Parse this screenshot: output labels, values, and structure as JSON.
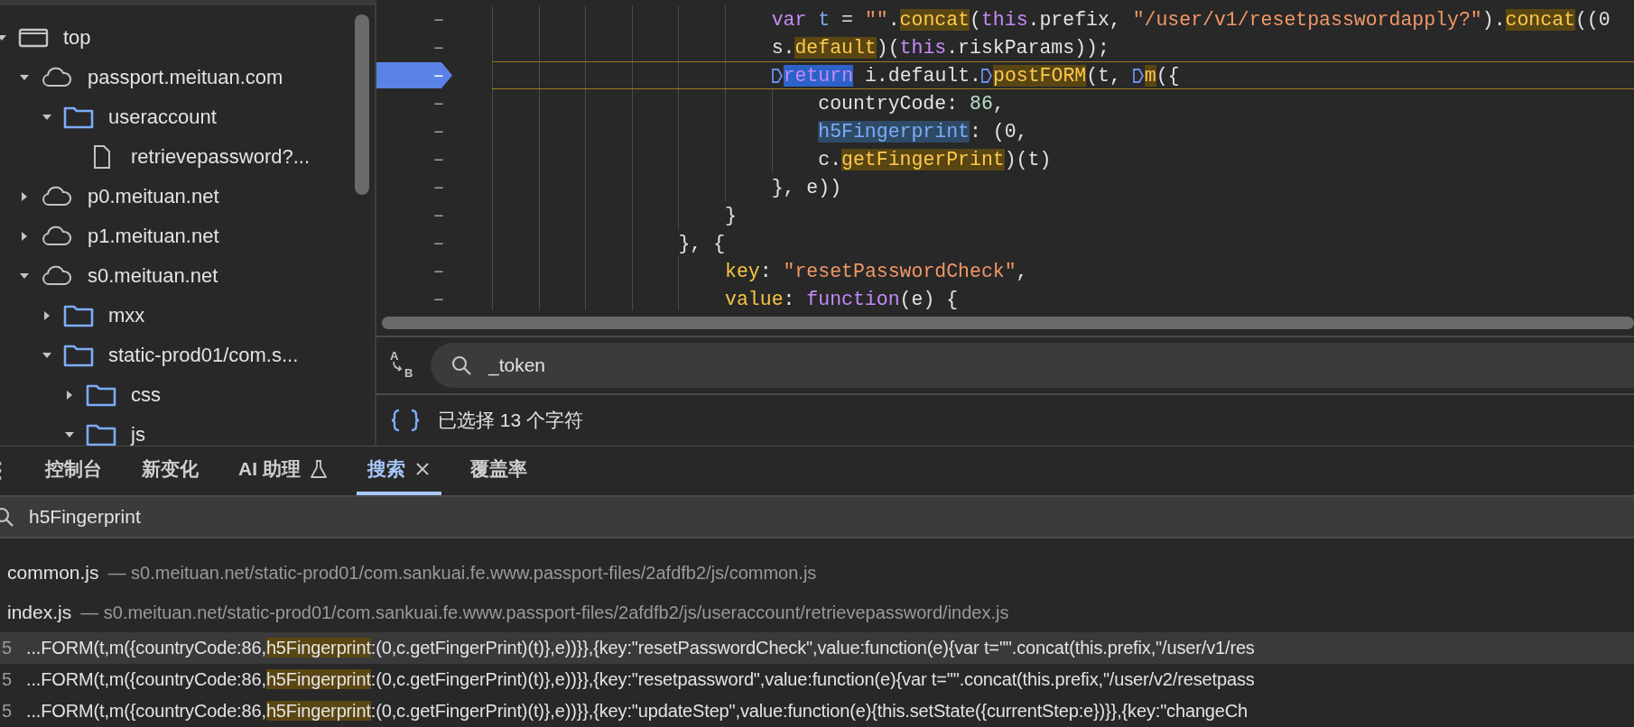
{
  "sidebar": {
    "tree": [
      {
        "label": "top",
        "kind": "frame",
        "expanded": true,
        "children": [
          {
            "label": "passport.meituan.com",
            "kind": "domain",
            "expanded": true,
            "children": [
              {
                "label": "useraccount",
                "kind": "folder",
                "expanded": true,
                "children": [
                  {
                    "label": "retrievepassword?...",
                    "kind": "file"
                  }
                ]
              }
            ]
          },
          {
            "label": "p0.meituan.net",
            "kind": "domain",
            "expanded": false
          },
          {
            "label": "p1.meituan.net",
            "kind": "domain",
            "expanded": false
          },
          {
            "label": "s0.meituan.net",
            "kind": "domain",
            "expanded": true,
            "children": [
              {
                "label": "mxx",
                "kind": "folder",
                "expanded": false
              },
              {
                "label": "static-prod01/com.s...",
                "kind": "folder",
                "expanded": true,
                "children": [
                  {
                    "label": "css",
                    "kind": "folder",
                    "expanded": false
                  },
                  {
                    "label": "js",
                    "kind": "folder",
                    "expanded": true
                  }
                ]
              }
            ]
          }
        ]
      }
    ]
  },
  "editor": {
    "lines": [
      {
        "gutter": "–",
        "breakpoint": false,
        "current": false,
        "tokens": [
          {
            "kind": "keyword",
            "t": "                        var "
          },
          {
            "kind": "variable",
            "t": "t"
          },
          {
            "kind": "plain",
            "t": " = "
          },
          {
            "kind": "string",
            "t": "\"\""
          },
          {
            "kind": "plain",
            "t": "."
          },
          {
            "kind": "hit",
            "t": "concat"
          },
          {
            "kind": "plain",
            "t": "("
          },
          {
            "kind": "keyword",
            "t": "this"
          },
          {
            "kind": "plain",
            "t": ".prefix, "
          },
          {
            "kind": "string",
            "t": "\"/user/v1/resetpasswordapply?\""
          },
          {
            "kind": "plain",
            "t": ")."
          },
          {
            "kind": "hit",
            "t": "concat"
          },
          {
            "kind": "plain",
            "t": "((0"
          }
        ]
      },
      {
        "gutter": "–",
        "breakpoint": false,
        "current": false,
        "tokens": [
          {
            "kind": "plain",
            "t": "                        s."
          },
          {
            "kind": "hit",
            "t": "default"
          },
          {
            "kind": "plain",
            "t": ")("
          },
          {
            "kind": "keyword",
            "t": "this"
          },
          {
            "kind": "plain",
            "t": ".riskParams));"
          }
        ]
      },
      {
        "gutter": "–",
        "breakpoint": true,
        "current": true,
        "tokens": [
          {
            "kind": "marker"
          },
          {
            "kind": "paused",
            "t": "                        return"
          },
          {
            "kind": "plain",
            "t": " i.default."
          },
          {
            "kind": "marker"
          },
          {
            "kind": "hit",
            "t": "postFORM"
          },
          {
            "kind": "plain",
            "t": "(t, "
          },
          {
            "kind": "marker"
          },
          {
            "kind": "hit",
            "t": "m"
          },
          {
            "kind": "plain",
            "t": "({"
          }
        ]
      },
      {
        "gutter": "–",
        "breakpoint": false,
        "current": false,
        "tokens": [
          {
            "kind": "plain",
            "t": "                            countryCode: "
          },
          {
            "kind": "number",
            "t": "86"
          },
          {
            "kind": "plain",
            "t": ","
          }
        ]
      },
      {
        "gutter": "–",
        "breakpoint": false,
        "current": false,
        "tokens": [
          {
            "kind": "selection",
            "t": "                            h5Fingerprint"
          },
          {
            "kind": "plain",
            "t": ": (0,"
          }
        ]
      },
      {
        "gutter": "–",
        "breakpoint": false,
        "current": false,
        "tokens": [
          {
            "kind": "plain",
            "t": "                            c."
          },
          {
            "kind": "hit",
            "t": "getFingerPrint"
          },
          {
            "kind": "plain",
            "t": ")(t)"
          }
        ]
      },
      {
        "gutter": "–",
        "breakpoint": false,
        "current": false,
        "tokens": [
          {
            "kind": "plain",
            "t": "                        }, e))"
          }
        ]
      },
      {
        "gutter": "–",
        "breakpoint": false,
        "current": false,
        "tokens": [
          {
            "kind": "plain",
            "t": "                    }"
          }
        ]
      },
      {
        "gutter": "–",
        "breakpoint": false,
        "current": false,
        "tokens": [
          {
            "kind": "plain",
            "t": "                }, {"
          }
        ]
      },
      {
        "gutter": "–",
        "breakpoint": false,
        "current": false,
        "tokens": [
          {
            "kind": "property",
            "t": "                    key"
          },
          {
            "kind": "plain",
            "t": ": "
          },
          {
            "kind": "string",
            "t": "\"resetPasswordCheck\""
          },
          {
            "kind": "plain",
            "t": ","
          }
        ]
      },
      {
        "gutter": "–",
        "breakpoint": false,
        "current": false,
        "tokens": [
          {
            "kind": "property",
            "t": "                    value"
          },
          {
            "kind": "plain",
            "t": ": "
          },
          {
            "kind": "keyword",
            "t": "function"
          },
          {
            "kind": "plain",
            "t": "(e) {"
          }
        ]
      }
    ],
    "search": {
      "toggle": {
        "top": "A",
        "bottom": "B"
      },
      "value": "_token"
    },
    "status": "已选择 13 个字符"
  },
  "panel": {
    "tabs": [
      {
        "label": "控制台",
        "selected": false
      },
      {
        "label": "新变化",
        "selected": false
      },
      {
        "label": "AI 助理",
        "selected": false,
        "kind": "lab"
      },
      {
        "label": "搜索",
        "selected": true,
        "kind": "closable"
      },
      {
        "label": "覆盖率",
        "selected": false
      }
    ],
    "search": {
      "value": "h5Fingerprint"
    },
    "files": [
      {
        "name": "common.js",
        "path": "— s0.meituan.net/static-prod01/com.sankuai.fe.www.passport-files/2afdfb2/js/common.js"
      },
      {
        "name": "index.js",
        "path": "— s0.meituan.net/static-prod01/com.sankuai.fe.www.passport-files/2afdfb2/js/useraccount/retrievepassword/index.js"
      }
    ],
    "matches": [
      {
        "line": "5",
        "selected": true,
        "before": "...FORM(t,m({countryCode:86,",
        "match": "h5Fingerprint",
        "after": ":(0,c.getFingerPrint)(t)},e))}},{key:\"resetPasswordCheck\",value:function(e){var t=\"\".concat(this.prefix,\"/user/v1/res"
      },
      {
        "line": "5",
        "selected": false,
        "before": "...FORM(t,m({countryCode:86,",
        "match": "h5Fingerprint",
        "after": ":(0,c.getFingerPrint)(t)},e))}},{key:\"resetpassword\",value:function(e){var t=\"\".concat(this.prefix,\"/user/v2/resetpass"
      },
      {
        "line": "5",
        "selected": false,
        "before": "...FORM(t,m({countryCode:86,",
        "match": "h5Fingerprint",
        "after": ":(0,c.getFingerPrint)(t)},e))}},{key:\"updateStep\",value:function(e){this.setState({currentStep:e})}},{key:\"changeCh"
      }
    ]
  }
}
